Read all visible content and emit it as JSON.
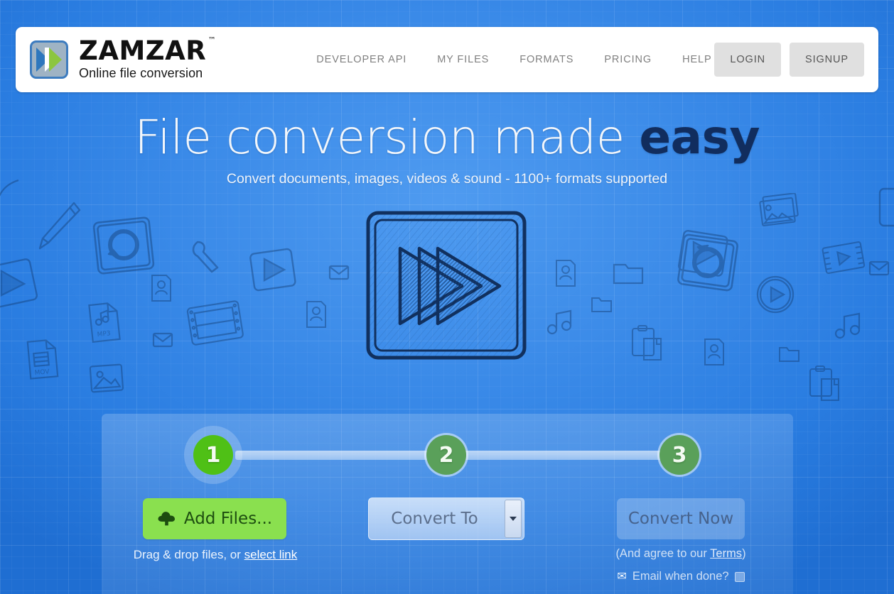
{
  "header": {
    "brand": {
      "name": "ZAMZAR",
      "trademark": "™",
      "tagline": "Online file conversion",
      "logo_icon": "double-chevron-logo-icon",
      "logo_colors": {
        "blue": "#2e77bd",
        "green": "#8cc63f",
        "frame": "#3d7cbf",
        "plate": "#9fb3c4"
      }
    },
    "nav": [
      {
        "label": "DEVELOPER API",
        "name": "nav-developer-api"
      },
      {
        "label": "MY FILES",
        "name": "nav-my-files"
      },
      {
        "label": "FORMATS",
        "name": "nav-formats"
      },
      {
        "label": "PRICING",
        "name": "nav-pricing"
      },
      {
        "label": "HELP",
        "name": "nav-help"
      }
    ],
    "login_label": "LOGIN",
    "signup_label": "SIGNUP"
  },
  "hero": {
    "headline_main": "File conversion made ",
    "headline_accent": "easy",
    "subheadline": "Convert documents, images, videos & sound - 1100+ formats supported",
    "illustration_icon": "fast-forward-sketch-icon"
  },
  "steps": {
    "step1_number": "1",
    "step2_number": "2",
    "step3_number": "3",
    "add_files_label": "Add Files...",
    "add_files_icon": "cloud-upload-icon",
    "convert_to_label": "Convert To",
    "convert_to_options": [
      "Convert To"
    ],
    "convert_now_label": "Convert Now",
    "drag_prefix": "Drag & drop files, or ",
    "select_link_label": "select link",
    "terms_prefix": "(And agree to our ",
    "terms_link_label": "Terms",
    "terms_suffix": ")",
    "email_icon": "✉",
    "email_label": "Email when done?",
    "email_checked": false
  },
  "colors": {
    "page_blue": "#2a7de1",
    "page_blue_light": "#4f9bf0",
    "accent_green": "#4fc016",
    "accent_green_muted": "#5aa05a",
    "add_files_green": "#8ae04f",
    "headline_accent_navy": "#112d5e",
    "card_white": "#ffffff",
    "button_gray": "#e0e0e0",
    "nav_gray": "#808080"
  }
}
